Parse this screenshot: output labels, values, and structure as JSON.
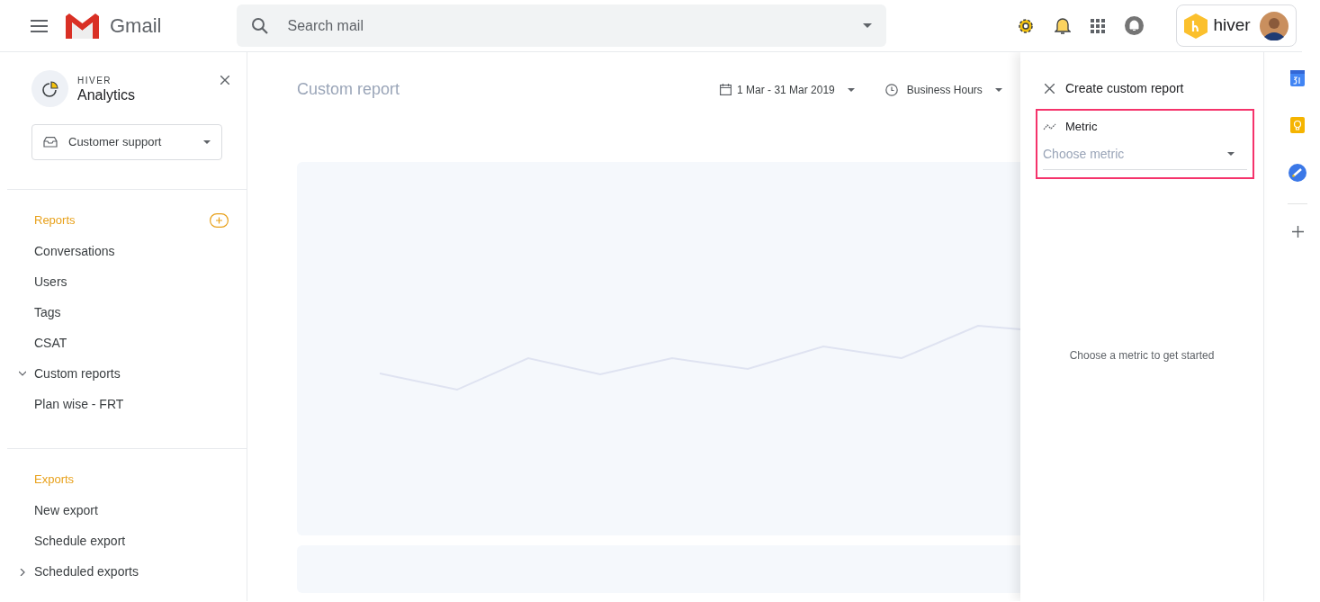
{
  "header": {
    "app_name": "Gmail",
    "search": {
      "placeholder": "Search mail"
    },
    "account_brand": "hiver"
  },
  "sidebar": {
    "brand": "HIVER",
    "title": "Analytics",
    "inbox_select": {
      "value": "Customer support"
    },
    "sections": [
      {
        "title": "Reports",
        "add_button": true,
        "items": [
          {
            "label": "Conversations",
            "kind": "link"
          },
          {
            "label": "Users",
            "kind": "link"
          },
          {
            "label": "Tags",
            "kind": "link"
          },
          {
            "label": "CSAT",
            "kind": "link"
          },
          {
            "label": "Custom reports",
            "kind": "group",
            "expanded": true
          },
          {
            "label": "Plan wise - FRT",
            "kind": "link"
          }
        ]
      },
      {
        "title": "Exports",
        "add_button": false,
        "items": [
          {
            "label": "New export",
            "kind": "link"
          },
          {
            "label": "Schedule export",
            "kind": "link"
          },
          {
            "label": "Scheduled exports",
            "kind": "group",
            "expanded": false
          }
        ]
      }
    ]
  },
  "report": {
    "title": "Custom report",
    "date_range": "1 Mar - 31 Mar 2019",
    "hours": "Business Hours"
  },
  "panel": {
    "title": "Create custom report",
    "metric": {
      "label": "Metric",
      "placeholder": "Choose metric",
      "highlighted": true
    },
    "empty_message": "Choose a metric to get started"
  }
}
